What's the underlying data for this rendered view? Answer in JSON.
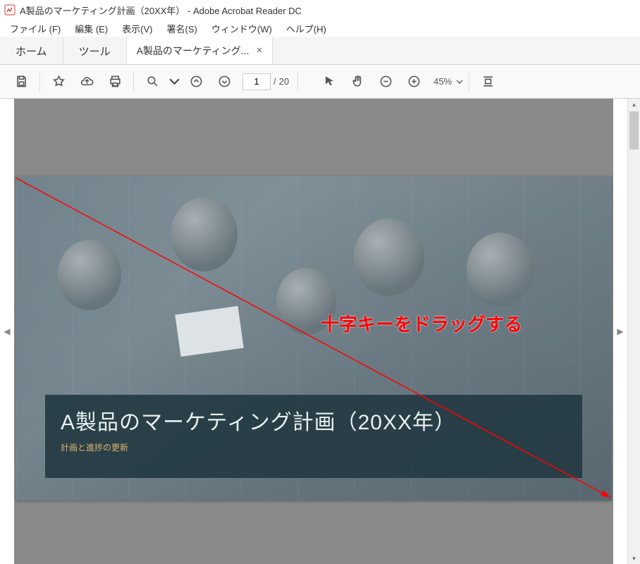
{
  "window": {
    "title": "A製品のマーケティング計画（20XX年） - Adobe Acrobat Reader DC"
  },
  "menu": {
    "file": "ファイル (F)",
    "edit": "編集 (E)",
    "view": "表示(V)",
    "sign": "署名(S)",
    "window": "ウィンドウ(W)",
    "help": "ヘルプ(H)"
  },
  "tabs": {
    "home": "ホーム",
    "tools": "ツール",
    "doc": "A製品のマーケティング..."
  },
  "toolbar": {
    "page_current": "1",
    "page_sep": "/",
    "page_total": "20",
    "zoom_value": "45%"
  },
  "slide": {
    "title": "A製品のマーケティング計画（20XX年）",
    "subtitle": "計画と進捗の更新"
  },
  "annotation": {
    "text": "十字キーをドラッグする"
  }
}
